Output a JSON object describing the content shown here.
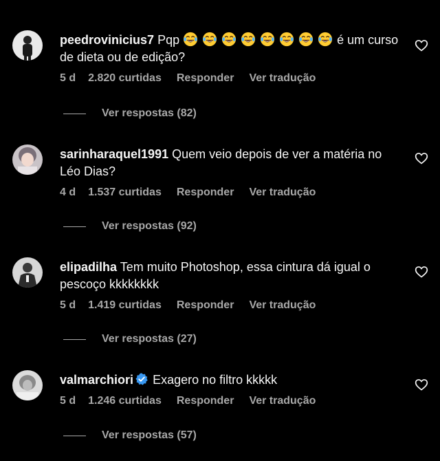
{
  "comments": [
    {
      "username": "peedrovinicius7",
      "text_before": "Pqp",
      "emoji_count": 8,
      "emoji": "😂",
      "text_after": "é um curso de dieta ou de edição?",
      "age": "5 d",
      "likes": "2.820 curtidas",
      "reply": "Responder",
      "translate": "Ver tradução",
      "replies": "Ver respostas (82)"
    },
    {
      "username": "sarinharaquel1991",
      "text": "Quem veio depois de ver a matéria no Léo Dias?",
      "age": "4 d",
      "likes": "1.537 curtidas",
      "reply": "Responder",
      "translate": "Ver tradução",
      "replies": "Ver respostas (92)"
    },
    {
      "username": "elipadilha",
      "text": "Tem muito Photoshop, essa cintura dá igual o pescoço kkkkkkkk",
      "age": "5 d",
      "likes": "1.419 curtidas",
      "reply": "Responder",
      "translate": "Ver tradução",
      "replies": "Ver respostas (27)"
    },
    {
      "username": "valmarchiori",
      "verified": true,
      "text": "Exagero no filtro kkkkk",
      "age": "5 d",
      "likes": "1.246 curtidas",
      "reply": "Responder",
      "translate": "Ver tradução",
      "replies": "Ver respostas (57)"
    }
  ],
  "colors": {
    "background": "#000000",
    "primary_text": "#f5f5f5",
    "secondary_text": "#a8a8a8",
    "verified_blue": "#3897f0"
  },
  "icons": {
    "like": "heart-outline-icon",
    "verified": "verified-badge-icon",
    "emoji": "face-with-tears-of-joy"
  }
}
